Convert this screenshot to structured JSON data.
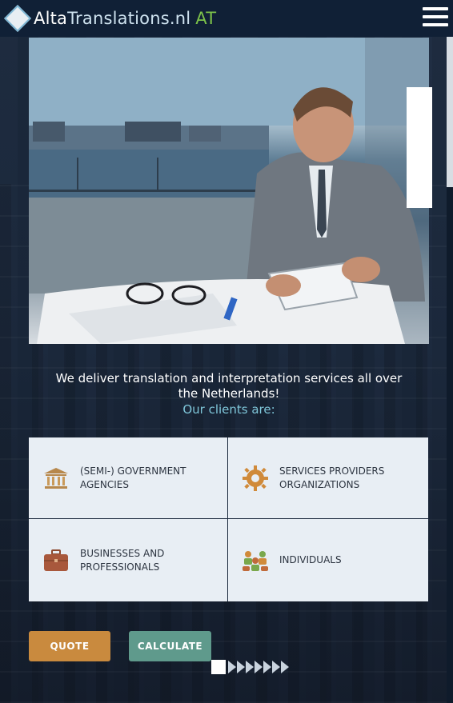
{
  "header": {
    "logo_bold": "Alta",
    "logo_light": "Translations.nl",
    "logo_suffix": "AT"
  },
  "hero": {
    "tagline": "We deliver translation and interpretation services all over the Netherlands!",
    "subline": "Our clients are:"
  },
  "clients": [
    {
      "label_line1": "(SEMI-) GOVERNMENT",
      "label_line2": "AGENCIES",
      "icon": "building-icon"
    },
    {
      "label_line1": "SERVICES PROVIDERS",
      "label_line2": "ORGANIZATIONS",
      "icon": "gear-icon"
    },
    {
      "label_line1": "BUSINESSES AND",
      "label_line2": "PROFESSIONALS",
      "icon": "briefcase-icon"
    },
    {
      "label_line1": "INDIVIDUALS",
      "label_line2": "",
      "icon": "people-icon"
    }
  ],
  "buttons": {
    "quote": "QUOTE",
    "calculate": "CALCULATE"
  },
  "colors": {
    "accent_orange": "#c98a3e",
    "accent_teal": "#5f9a8c",
    "logo_green": "#7cc24a",
    "subline_cyan": "#7fc6d9"
  }
}
